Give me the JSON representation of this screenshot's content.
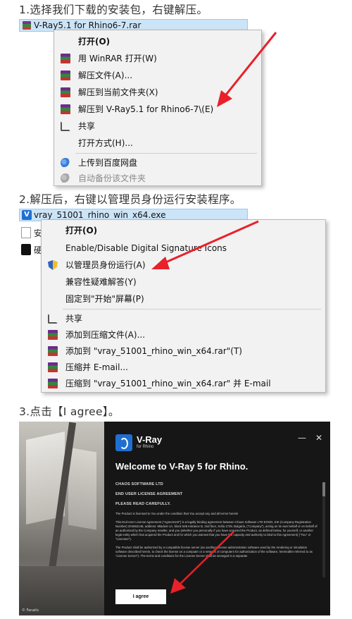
{
  "step1": {
    "caption": "1.选择我们下载的安装包，右键解压。",
    "file_name": "V-Ray5.1 for Rhino6-7.rar",
    "menu": [
      {
        "label": "打开(O)",
        "icon": "",
        "bold": true
      },
      {
        "label": "用 WinRAR 打开(W)",
        "icon": "winrar-icon"
      },
      {
        "label": "解压文件(A)...",
        "icon": "winrar-icon"
      },
      {
        "label": "解压到当前文件夹(X)",
        "icon": "winrar-icon"
      },
      {
        "label": "解压到 V-Ray5.1 for Rhino6-7\\(E)",
        "icon": "winrar-icon"
      },
      {
        "label": "共享",
        "icon": "share-icon"
      },
      {
        "label": "打开方式(H)...",
        "icon": ""
      },
      {
        "label": "上传到百度网盘",
        "icon": "baidu-cloud-icon"
      },
      {
        "label": "自动备份该文件夹",
        "icon": "baidu-cloud-icon",
        "grey": true
      }
    ]
  },
  "step2": {
    "caption": "2.解压后，右键以管理员身份运行安装程序。",
    "file_name": "vray_51001_rhino_win_x64.exe",
    "side_labels": [
      "安",
      "硬"
    ],
    "menu": [
      {
        "label": "打开(O)",
        "icon": "",
        "bold": true
      },
      {
        "label": "Enable/Disable Digital Signature Icons",
        "icon": ""
      },
      {
        "label": "以管理员身份运行(A)",
        "icon": "uac-shield-icon"
      },
      {
        "label": "兼容性疑难解答(Y)",
        "icon": ""
      },
      {
        "label": "固定到\"开始\"屏幕(P)",
        "icon": ""
      },
      {
        "label": "共享",
        "icon": "share-icon"
      },
      {
        "label": "添加到压缩文件(A)...",
        "icon": "winrar-icon"
      },
      {
        "label": "添加到 \"vray_51001_rhino_win_x64.rar\"(T)",
        "icon": "winrar-icon"
      },
      {
        "label": "压缩并 E-mail...",
        "icon": "winrar-icon"
      },
      {
        "label": "压缩到 \"vray_51001_rhino_win_x64.rar\" 并 E-mail",
        "icon": "winrar-icon"
      }
    ]
  },
  "step3": {
    "caption": "3.点击【I agree】。",
    "logo_title": "V-Ray",
    "logo_sub": "for Rhino",
    "minimize": "—",
    "close": "✕",
    "welcome": "Welcome to V-Ray 5 for Rhino.",
    "license_lines": [
      "CHAOS SOFTWARE LTD",
      "END USER LICENSE AGREEMENT",
      "PLEASE READ CAREFULLY."
    ],
    "license_paragraphs": [
      "The Product is licensed to You under the condition that You accept any and all terms herein!",
      "This End User License Agreement (\"Agreement\") is a legally binding agreement between Chaos Software LTD EOOD, EIK (Company Registration Number) 204662148, address: Mladost-1A, block 548 entrance B, 2nd floor, Sofia 1729, Bulgaria, (\"Company\"), acting on its own behalf or on behalf of an authorized by the Company reseller, and you (whether you personally if you have acquired the Product, as defined below, for yourself, or another legal entity which has acquired the Product and for which you warrant that you have the capacity and authority to bind to this Agreement) (\"You\" or \"Licensee\").",
      "The Product shall be authorized by a compatible license server (an ancillary license administration software used by the rendering or simulation software described herein, to check the license on a computer or a network of computers for authorization of the software, hereinafter referred to as \"License Server\"). The terms and conditions for the License Server shall be arranged in a separate"
    ],
    "agree_button": "I agree",
    "photo_mark": "© Fanatic"
  },
  "colors": {
    "arrow": "#e8212a",
    "selection": "#cce4f7",
    "vray_blue": "#1f6fd1"
  }
}
